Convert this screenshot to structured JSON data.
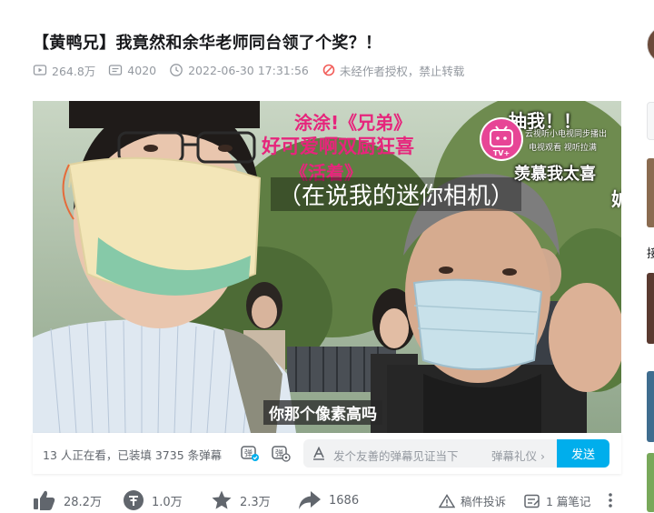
{
  "video": {
    "title": "【黄鸭兄】我竟然和余华老师同台领了个奖？！",
    "views": "264.8万",
    "danmaku_count": "4020",
    "datetime": "2022-06-30 17:31:56",
    "copyright_notice": "未经作者授权，禁止转载"
  },
  "subtitles": {
    "line1": "涂涂!《兄弟》",
    "line2": "好可爱啊双厨狂喜",
    "line3": "《活着》",
    "line4": "（在说我的迷你相机）",
    "line5": "抽我！！",
    "line6": "羡慕我太喜",
    "line7": "妒",
    "caption": "你那个像素高吗",
    "logo_text1": "云视听小电视同步播出",
    "logo_text2": "电视观看 视听拉满",
    "logo_badge": "TV+"
  },
  "danmaku_bar": {
    "watching": "13 人正在看，已装填 3735 条弹幕",
    "input_placeholder": "发个友善的弹幕见证当下",
    "etiquette": "弹幕礼仪 ›",
    "send": "发送",
    "toggle_icon": "danmaku-toggle-icon",
    "settings_icon": "danmaku-settings-icon"
  },
  "actions": {
    "like": "28.2万",
    "coin": "1.0万",
    "favorite": "2.3万",
    "share": "1686",
    "report": "稿件投诉",
    "notes": "1 篇笔记"
  },
  "sidebar": {
    "partial_label": "接"
  },
  "colors": {
    "accent": "#00aeec",
    "icon_dark": "#61666d",
    "pink_subtitle": "#e6257c",
    "meta_gray": "#9499a0"
  }
}
